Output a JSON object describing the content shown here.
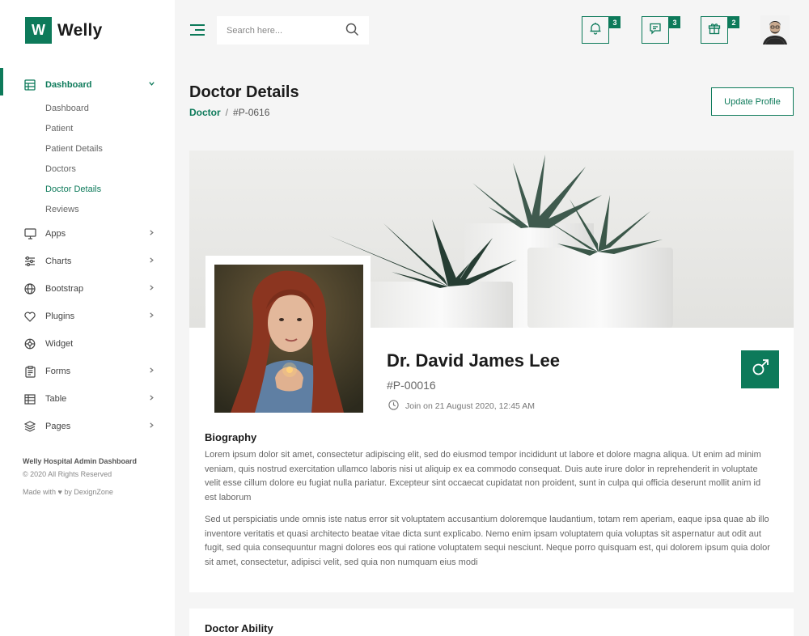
{
  "brand": {
    "mark": "W",
    "name": "Welly"
  },
  "sidebar": {
    "items": [
      {
        "label": "Dashboard",
        "icon": "dashboard-icon",
        "expanded": true,
        "children": [
          "Dashboard",
          "Patient",
          "Patient Details",
          "Doctors",
          "Doctor Details",
          "Reviews"
        ]
      },
      {
        "label": "Apps",
        "icon": "monitor-icon"
      },
      {
        "label": "Charts",
        "icon": "sliders-icon"
      },
      {
        "label": "Bootstrap",
        "icon": "globe-icon"
      },
      {
        "label": "Plugins",
        "icon": "heart-icon"
      },
      {
        "label": "Widget",
        "icon": "gear-icon"
      },
      {
        "label": "Forms",
        "icon": "clipboard-icon"
      },
      {
        "label": "Table",
        "icon": "table-icon"
      },
      {
        "label": "Pages",
        "icon": "layers-icon"
      }
    ],
    "footer": {
      "title": "Welly Hospital Admin Dashboard",
      "copyright": "© 2020 All Rights Reserved",
      "made_with": "Made with ♥ by DexignZone"
    }
  },
  "header": {
    "search_placeholder": "Search here...",
    "notifications_count": "3",
    "messages_count": "3",
    "gifts_count": "2"
  },
  "page": {
    "title": "Doctor Details",
    "breadcrumb": {
      "parent": "Doctor",
      "separator": "/",
      "current": "#P-0616"
    },
    "update_button": "Update Profile"
  },
  "profile": {
    "name": "Dr. David James Lee",
    "id": "#P-00016",
    "joined": "Join on 21 August 2020, 12:45 AM",
    "gender_icon": "male-icon"
  },
  "biography": {
    "title": "Biography",
    "p1": "Lorem ipsum dolor sit amet, consectetur adipiscing elit, sed do eiusmod tempor incididunt ut labore et dolore magna aliqua. Ut enim ad minim veniam, quis nostrud exercitation ullamco laboris nisi ut aliquip ex ea commodo consequat. Duis aute irure dolor in reprehenderit in voluptate velit esse cillum dolore eu fugiat nulla pariatur. Excepteur sint occaecat cupidatat non proident, sunt in culpa qui officia deserunt mollit anim id est laborum",
    "p2": "Sed ut perspiciatis unde omnis iste natus error sit voluptatem accusantium doloremque laudantium, totam rem aperiam, eaque ipsa quae ab illo inventore veritatis et quasi architecto beatae vitae dicta sunt explicabo. Nemo enim ipsam voluptatem quia voluptas sit aspernatur aut odit aut fugit, sed quia consequuntur magni dolores eos qui ratione voluptatem sequi nesciunt. Neque porro quisquam est, qui dolorem ipsum quia dolor sit amet, consectetur, adipisci velit, sed quia non numquam eius modi"
  },
  "ability": {
    "title": "Doctor Ability"
  },
  "colors": {
    "accent": "#0d7a5a",
    "background": "#f5f5f5"
  }
}
